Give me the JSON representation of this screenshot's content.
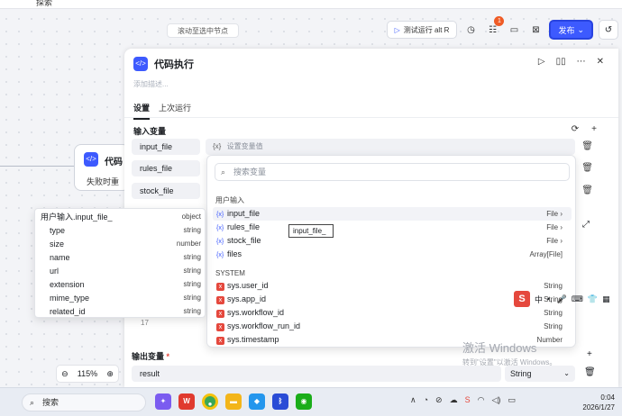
{
  "topbar": {
    "tab_label": "探索"
  },
  "canvas": {
    "scroll_to_selected": "滚动至选中节点"
  },
  "toolbar": {
    "test_run": "测试运行 alt R",
    "badge_count": "1",
    "publish": "发布"
  },
  "node": {
    "title": "代码",
    "subtitle": "失败时重"
  },
  "panel": {
    "title": "代码执行",
    "description_placeholder": "添加描述...",
    "tabs": [
      {
        "label": "设置"
      },
      {
        "label": "上次运行"
      }
    ],
    "inputs_title": "输入变量",
    "inputs": [
      {
        "name": "input_file",
        "value_placeholder": "设置变量值"
      },
      {
        "name": "rules_file"
      },
      {
        "name": "stock_file"
      }
    ],
    "value_prefix": "{x}",
    "hidden_row_label": "17",
    "outputs_title": "输出变量",
    "required_mark": "*",
    "output": {
      "name": "result",
      "type": "String"
    }
  },
  "dropdown": {
    "search_placeholder": "搜索变量",
    "user_group": "用户输入",
    "user_items": [
      {
        "name": "input_file",
        "type": "File"
      },
      {
        "name": "rules_file",
        "type": "File"
      },
      {
        "name": "stock_file",
        "type": "File"
      },
      {
        "name": "files",
        "type": "Array[File]"
      }
    ],
    "system_group": "SYSTEM",
    "system_items": [
      {
        "name": "sys.user_id",
        "type": "String"
      },
      {
        "name": "sys.app_id",
        "type": "String"
      },
      {
        "name": "sys.workflow_id",
        "type": "String"
      },
      {
        "name": "sys.workflow_run_id",
        "type": "String"
      },
      {
        "name": "sys.timestamp",
        "type": "Number"
      }
    ]
  },
  "tooltip": {
    "text": "input_file_"
  },
  "object_popup": {
    "header": {
      "name": "用户输入.input_file_",
      "type": "object"
    },
    "fields": [
      {
        "name": "type",
        "type": "string"
      },
      {
        "name": "size",
        "type": "number"
      },
      {
        "name": "name",
        "type": "string"
      },
      {
        "name": "url",
        "type": "string"
      },
      {
        "name": "extension",
        "type": "string"
      },
      {
        "name": "mime_type",
        "type": "string"
      },
      {
        "name": "related_id",
        "type": "string"
      }
    ]
  },
  "zoom": {
    "level": "115%"
  },
  "watermark": {
    "line1": "激活 Windows",
    "line2": "转到\"设置\"以激活 Windows。"
  },
  "ime": {
    "label": "中"
  },
  "taskbar": {
    "search": "搜索",
    "time": "0:04",
    "date": "2026/1/27",
    "apps": [
      {
        "name": "copilot",
        "color": "#7b5cf0"
      },
      {
        "name": "wps",
        "color": "#e03a2f"
      },
      {
        "name": "chrome",
        "color": "#3aa757"
      },
      {
        "name": "explorer",
        "color": "#f3b51a"
      },
      {
        "name": "docker",
        "color": "#2496ed"
      },
      {
        "name": "bluetooth-tool",
        "color": "#2a4cd6"
      },
      {
        "name": "wechat",
        "color": "#1aad19"
      }
    ]
  },
  "colors": {
    "accent": "#3d5afe",
    "danger": "#e5483d"
  }
}
